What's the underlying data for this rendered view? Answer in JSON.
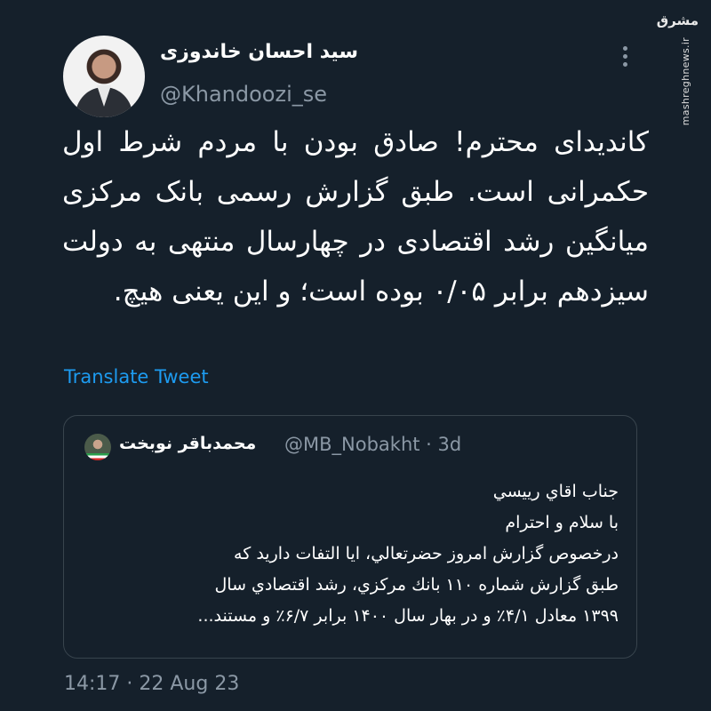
{
  "tweet": {
    "display_name": "سید احسان خاندوزی",
    "handle": "@Khandoozi_se",
    "text": "کاندیدای محترم! صادق بودن با مردم شرط اول حکمرانی است. طبق گزارش رسمی بانک مرکزی میانگین رشد اقتصادی در چهارسال منتهی به دولت سیزدهم برابر ۰/۰۵ بوده است؛ و این یعنی هیچ.",
    "translate_label": "Translate Tweet",
    "timestamp": "14:17 · 22 Aug 23"
  },
  "quoted": {
    "display_name": "محمدباقر نوبخت",
    "meta": "@MB_Nobakht · 3d",
    "text": "جناب اقاي رييسي\nبا سلام و احترام\nدرخصوص گزارش امروز حضرتعالي، ايا التفات داريد كه\nطبق گزارش شماره ۱۱۰ بانك مركزي، رشد اقتصادي سال\n۱۳۹۹ معادل ۴/۱٪ و در بهار سال ۱۴۰۰ برابر ۶/۷٪ و مستند..."
  },
  "watermark": {
    "logo_text": "مشرق",
    "site": "mashreghnews.ir"
  },
  "icons": {
    "more": "more-vertical-icon",
    "avatar": "profile-photo",
    "quoted_avatar": "profile-photo-small"
  },
  "colors": {
    "background": "#15202b",
    "text": "#ffffff",
    "secondary": "#8b98a5",
    "link": "#1d9bf0",
    "border": "#38444d"
  }
}
